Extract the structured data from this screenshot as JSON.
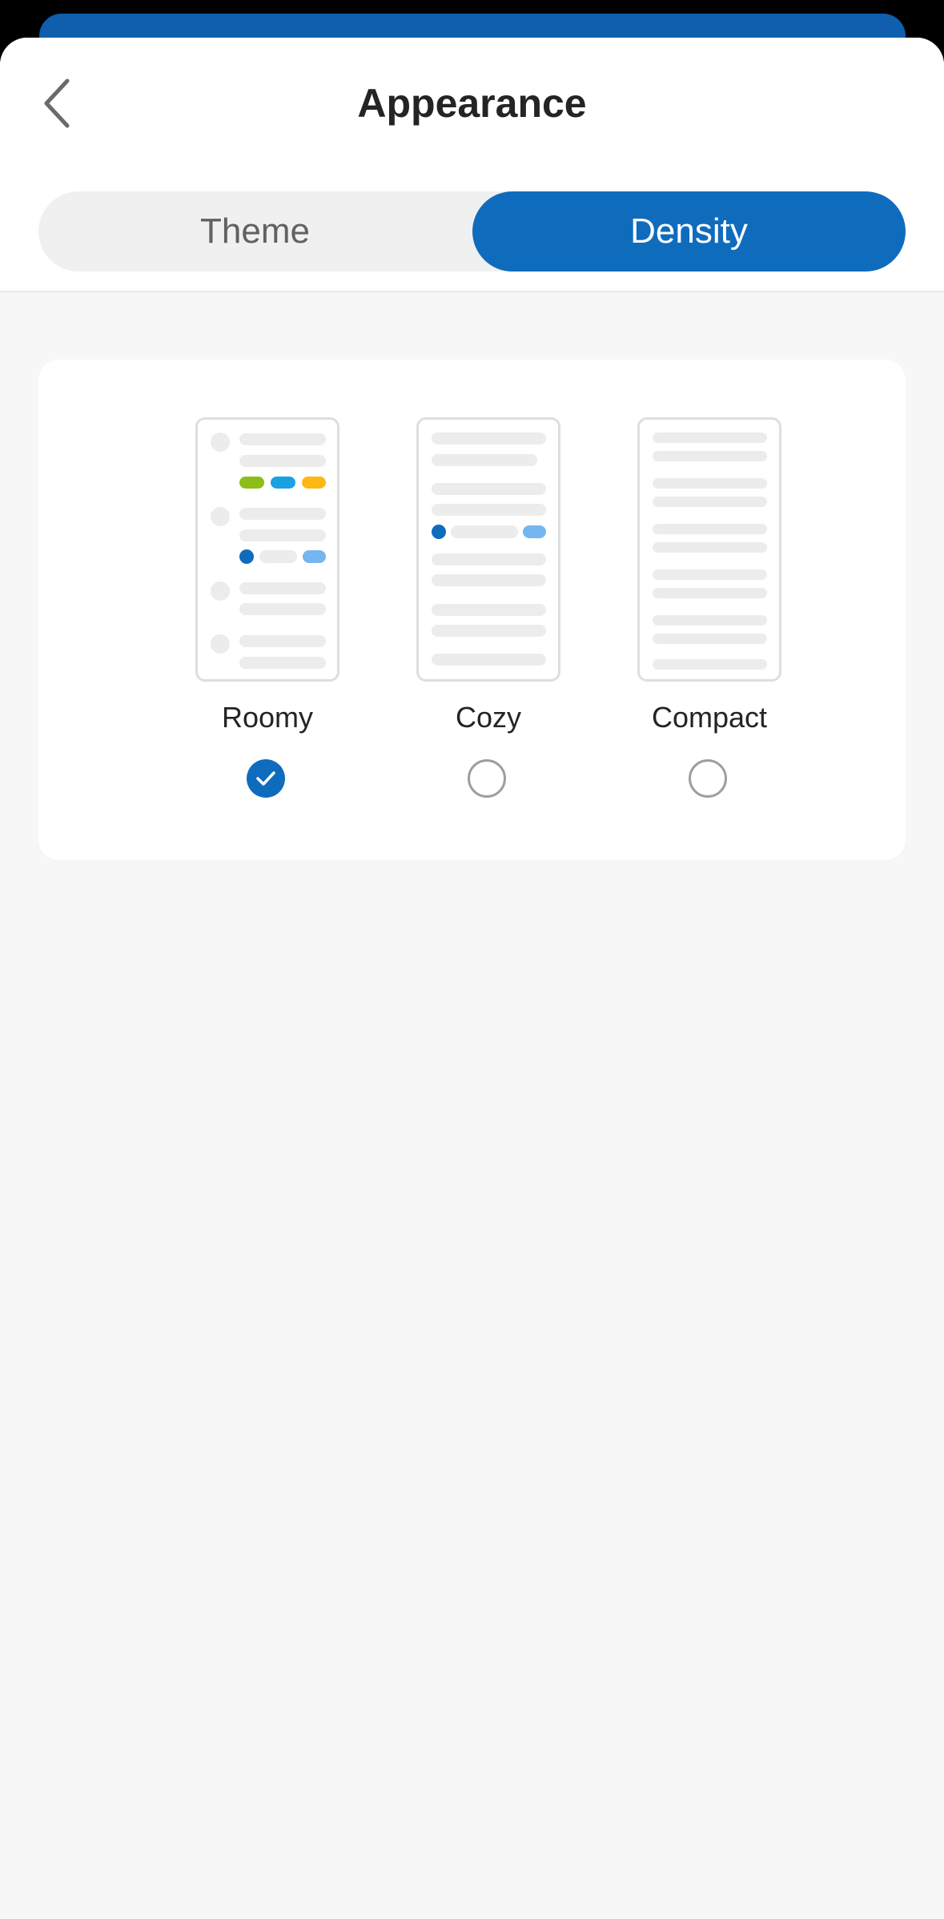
{
  "header": {
    "title": "Appearance",
    "back_icon": "chevron-left-icon"
  },
  "tabs": [
    {
      "label": "Theme",
      "selected": false
    },
    {
      "label": "Density",
      "selected": true
    }
  ],
  "density_options": [
    {
      "label": "Roomy",
      "selected": true,
      "preview_icon": "roomy-preview-icon"
    },
    {
      "label": "Cozy",
      "selected": false,
      "preview_icon": "cozy-preview-icon"
    },
    {
      "label": "Compact",
      "selected": false,
      "preview_icon": "compact-preview-icon"
    }
  ],
  "colors": {
    "accent": "#0f6cbd",
    "sheet_background": "#f7f7f7",
    "card_background": "#ffffff",
    "tab_track": "#f0f0f0",
    "preview_lines": "#ececec",
    "tag_green": "#8cbd18",
    "tag_blue": "#1ba1e2",
    "tag_yellow": "#fdb813",
    "tag_light_blue": "#75b6f0"
  }
}
